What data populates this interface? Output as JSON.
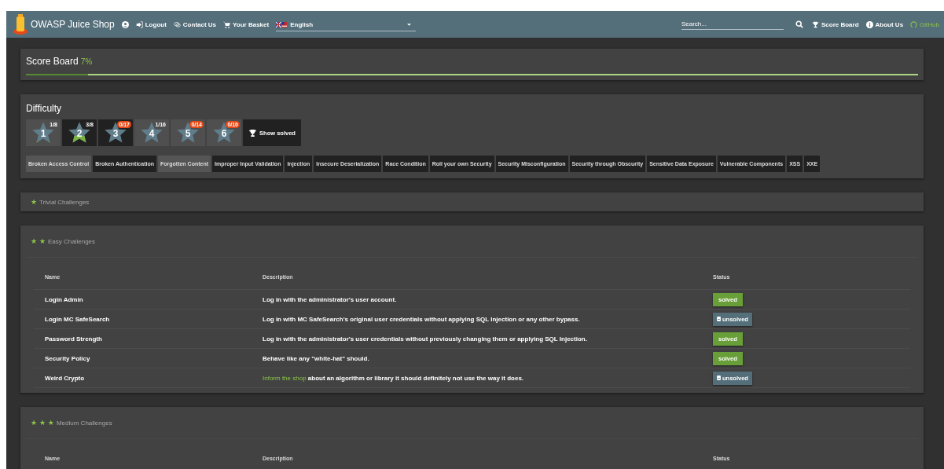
{
  "navbar": {
    "title": "OWASP Juice Shop",
    "links": [
      {
        "kind": "logout",
        "label": "Logout"
      },
      {
        "kind": "contact",
        "label": "Contact Us"
      },
      {
        "kind": "basket",
        "label": "Your Basket"
      }
    ],
    "language": "English",
    "search": {
      "placeholder": "Search..."
    },
    "right_links": [
      {
        "kind": "trophy",
        "label": "Score Board"
      },
      {
        "kind": "info",
        "label": "About Us"
      },
      {
        "kind": "github",
        "label": "GitHub"
      }
    ]
  },
  "score_board": {
    "title": "Score Board",
    "percent": "7%",
    "level": 0.07
  },
  "difficulty": {
    "title": "Difficulty",
    "stars": [
      {
        "number": "1",
        "count": "1/8",
        "alert": false,
        "selected": false
      },
      {
        "number": "2",
        "count": "3/8",
        "alert": false,
        "selected": true
      },
      {
        "number": "3",
        "count": "0/17",
        "alert": true,
        "selected": true
      },
      {
        "number": "4",
        "count": "1/16",
        "alert": false,
        "selected": false
      },
      {
        "number": "5",
        "count": "0/14",
        "alert": true,
        "selected": false
      },
      {
        "number": "6",
        "count": "0/10",
        "alert": true,
        "selected": false
      }
    ],
    "show_solved": {
      "label": "Show solved",
      "selected": true
    },
    "categories": [
      {
        "label": "Broken Access Control",
        "selected": false
      },
      {
        "label": "Broken Authentication",
        "selected": true
      },
      {
        "label": "Forgotten Content",
        "selected": false
      },
      {
        "label": "Improper Input Validation",
        "selected": true
      },
      {
        "label": "Injection",
        "selected": true
      },
      {
        "label": "Insecure Deserialization",
        "selected": true
      },
      {
        "label": "Race Condition",
        "selected": true
      },
      {
        "label": "Roll your own Security",
        "selected": true
      },
      {
        "label": "Security Misconfiguration",
        "selected": true
      },
      {
        "label": "Security through Obscurity",
        "selected": true
      },
      {
        "label": "Sensitive Data Exposure",
        "selected": true
      },
      {
        "label": "Vulnerable Components",
        "selected": true
      },
      {
        "label": "XSS",
        "selected": true
      },
      {
        "label": "XXE",
        "selected": true
      }
    ]
  },
  "sections": [
    {
      "title": "Trivial Challenges",
      "star_glyphs": "★",
      "expanded": false
    },
    {
      "title": "Easy Challenges",
      "star_glyphs": "★ ★",
      "expanded": true,
      "columns": [
        "Name",
        "Description",
        "Status"
      ],
      "rows": [
        {
          "name": "Login Admin",
          "description": "Log in with the administrator's user account.",
          "status": "solved",
          "solved": true
        },
        {
          "name": "Login MC SafeSearch",
          "description": "Log in with MC SafeSearch's original user credentials without applying SQL Injection or any other bypass.",
          "status": "unsolved",
          "solved": false
        },
        {
          "name": "Password Strength",
          "description": "Log in with the administrator's user credentials without previously changing them or applying SQL Injection.",
          "status": "solved",
          "solved": true
        },
        {
          "name": "Security Policy",
          "description": "Behave like any \"white-hat\" should.",
          "status": "solved",
          "solved": true
        },
        {
          "name": "Weird Crypto",
          "description_link": "Inform the shop",
          "description": " about an algorithm or library it should definitely not use the way it does.",
          "status": "unsolved",
          "solved": false
        }
      ]
    },
    {
      "title": "Medium Challenges",
      "star_glyphs": "★ ★ ★",
      "expanded": true,
      "columns": [
        "Name",
        "Description",
        "Status"
      ]
    }
  ]
}
